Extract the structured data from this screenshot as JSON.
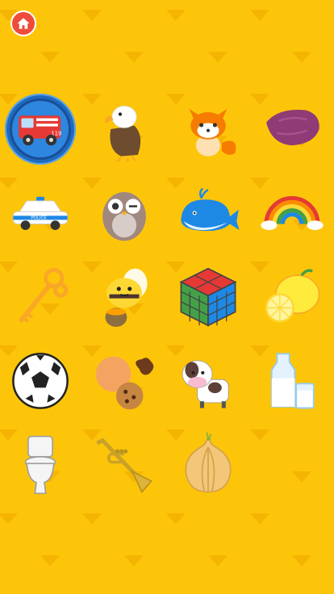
{
  "app": {
    "home_button": {
      "icon": "home-icon",
      "color": "#EE4B3B"
    },
    "background_color": "#FDC50A",
    "pattern_color": "#F5B402"
  },
  "grid": {
    "selected_index": 0,
    "items": [
      {
        "name": "fire-truck",
        "text": "119"
      },
      {
        "name": "eagle"
      },
      {
        "name": "fox"
      },
      {
        "name": "sweet-potato"
      },
      {
        "name": "police-car",
        "text": "POLICE"
      },
      {
        "name": "owl"
      },
      {
        "name": "whale"
      },
      {
        "name": "rainbow"
      },
      {
        "name": "key"
      },
      {
        "name": "bee"
      },
      {
        "name": "rubiks-cube"
      },
      {
        "name": "lemon"
      },
      {
        "name": "soccer-ball"
      },
      {
        "name": "cookies"
      },
      {
        "name": "cow"
      },
      {
        "name": "milk"
      },
      {
        "name": "toilet"
      },
      {
        "name": "trumpet"
      },
      {
        "name": "onion"
      }
    ]
  }
}
